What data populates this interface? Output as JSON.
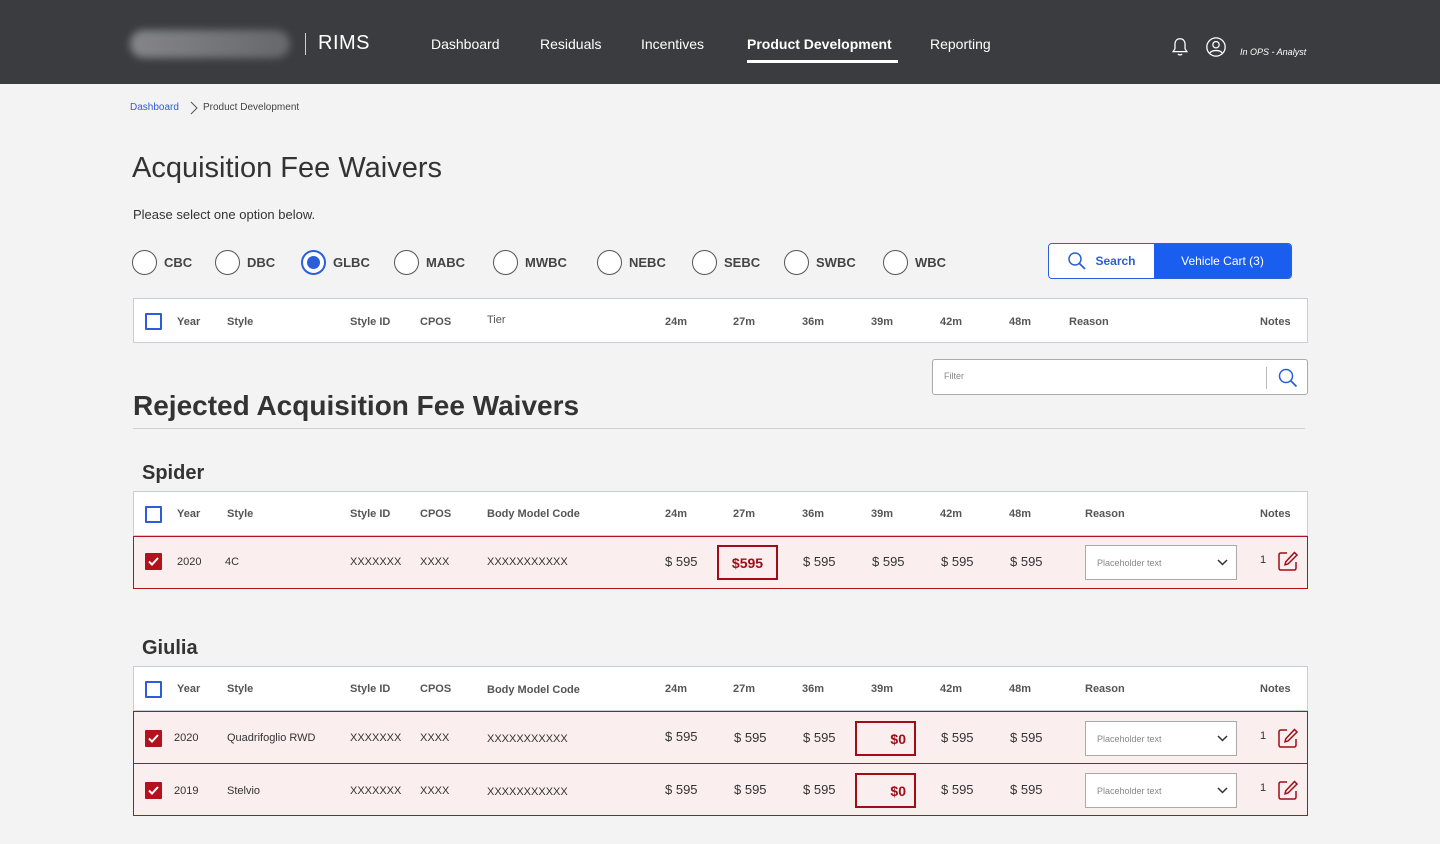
{
  "header": {
    "app_name": "RIMS",
    "nav": [
      "Dashboard",
      "Residuals",
      "Incentives",
      "Product Development",
      "Reporting"
    ],
    "active_nav": "Product Development",
    "user_label": "In OPS - Analyst"
  },
  "breadcrumb": {
    "link": "Dashboard",
    "current": "Product Development"
  },
  "page": {
    "title": "Acquisition Fee Waivers",
    "instruction": "Please select one option below."
  },
  "options": {
    "items": [
      "CBC",
      "DBC",
      "GLBC",
      "MABC",
      "MWBC",
      "NEBC",
      "SEBC",
      "SWBC",
      "WBC"
    ],
    "selected": "GLBC"
  },
  "actions": {
    "search_label": "Search",
    "cart_label": "Vehicle Cart (3)"
  },
  "main_table": {
    "headers": [
      "Year",
      "Style",
      "Style ID",
      "CPOS",
      "Tier",
      "24m",
      "27m",
      "36m",
      "39m",
      "42m",
      "48m",
      "Reason",
      "Notes"
    ]
  },
  "filter": {
    "placeholder": "Filter"
  },
  "rejected": {
    "title": "Rejected Acquisition Fee Waivers",
    "headers": [
      "Year",
      "Style",
      "Style ID",
      "CPOS",
      "Body Model Code",
      "24m",
      "27m",
      "36m",
      "39m",
      "42m",
      "48m",
      "Reason",
      "Notes"
    ],
    "groups": [
      {
        "name": "Spider",
        "rows": [
          {
            "year": "2020",
            "style": "4C",
            "style_id": "XXXXXXX",
            "cpos": "XXXX",
            "body": "XXXXXXXXXXX",
            "prices": [
              "$ 595",
              "$595",
              "$ 595",
              "$ 595",
              "$ 595",
              "$ 595"
            ],
            "flagged_index": 1,
            "reason_placeholder": "Placeholder text",
            "notes": "1"
          }
        ]
      },
      {
        "name": "Giulia",
        "rows": [
          {
            "year": "2020",
            "style": "Quadrifoglio RWD",
            "style_id": "XXXXXXX",
            "cpos": "XXXX",
            "body": "XXXXXXXXXXX",
            "prices": [
              "$ 595",
              "$ 595",
              "$ 595",
              "$0",
              "$ 595",
              "$ 595"
            ],
            "flagged_index": 3,
            "reason_placeholder": "Placeholder text",
            "notes": "1"
          },
          {
            "year": "2019",
            "style": "Stelvio",
            "style_id": "XXXXXXX",
            "cpos": "XXXX",
            "body": "XXXXXXXXXXX",
            "prices": [
              "$ 595",
              "$ 595",
              "$ 595",
              "$0",
              "$ 595",
              "$ 595"
            ],
            "flagged_index": 3,
            "reason_placeholder": "Placeholder text",
            "notes": "1"
          }
        ]
      }
    ]
  }
}
